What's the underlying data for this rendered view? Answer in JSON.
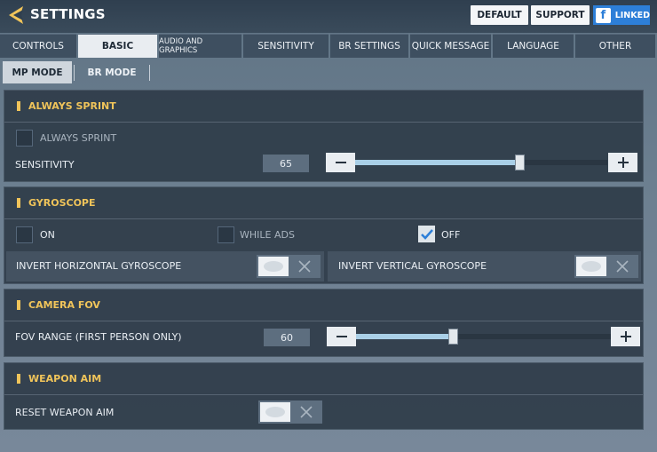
{
  "header": {
    "title": "SETTINGS",
    "default_label": "DEFAULT",
    "support_label": "SUPPORT",
    "linked_label": "LINKED",
    "facebook_glyph": "f"
  },
  "tabs": [
    {
      "label": "CONTROLS"
    },
    {
      "label": "BASIC"
    },
    {
      "label": "AUDIO AND GRAPHICS"
    },
    {
      "label": "SENSITIVITY"
    },
    {
      "label": "BR SETTINGS"
    },
    {
      "label": "QUICK MESSAGE"
    },
    {
      "label": "LANGUAGE"
    },
    {
      "label": "OTHER"
    }
  ],
  "subtabs": [
    {
      "label": "MP MODE"
    },
    {
      "label": "BR MODE"
    }
  ],
  "always_sprint": {
    "title": "ALWAYS SPRINT",
    "checkbox_label": "ALWAYS SPRINT",
    "sensitivity_label": "SENSITIVITY",
    "sensitivity_value": "65",
    "slider_fraction": 0.65
  },
  "gyroscope": {
    "title": "GYROSCOPE",
    "on_label": "ON",
    "while_ads_label": "WHILE ADS",
    "off_label": "OFF",
    "invert_h_label": "INVERT HORIZONTAL GYROSCOPE",
    "invert_v_label": "INVERT VERTICAL GYROSCOPE"
  },
  "camera_fov": {
    "title": "CAMERA FOV",
    "fov_label": "FOV RANGE (FIRST PERSON ONLY)",
    "fov_value": "60",
    "slider_fraction": 0.38
  },
  "weapon_aim": {
    "title": "WEAPON AIM",
    "reset_label": "RESET WEAPON AIM"
  },
  "colors": {
    "accent_yellow": "#f0c45a",
    "slider_fill": "#a9cfe7",
    "facebook_blue": "#2d7fd8"
  }
}
